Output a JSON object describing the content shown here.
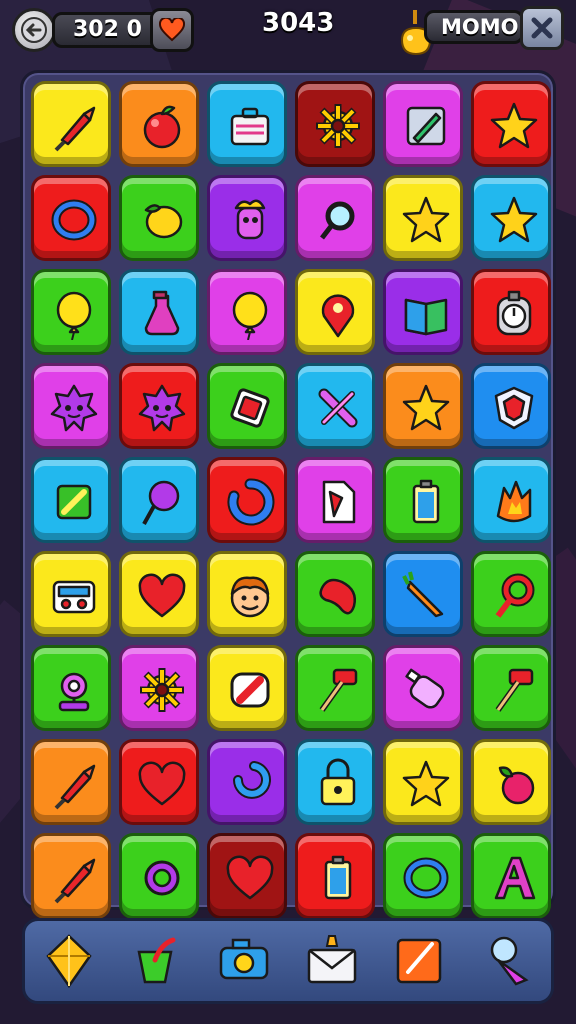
{
  "hud": {
    "score_left": "302 0",
    "center_score": "3043",
    "player_name": "MOMO"
  },
  "colors": {
    "yellow": "#fbe81c",
    "orange": "#fb8c1c",
    "cyan": "#22b8ee",
    "darkred": "#a01414",
    "magenta": "#e040e8",
    "red": "#ee1c1c",
    "green": "#3cd01c",
    "purple": "#9a2ee8",
    "blue": "#1f8ef0"
  },
  "board": {
    "rows": [
      [
        {
          "c": "yellow",
          "i": "rocket-icon"
        },
        {
          "c": "orange",
          "i": "apple-icon"
        },
        {
          "c": "cyan",
          "i": "briefcase-icon"
        },
        {
          "c": "darkred",
          "i": "gear-icon"
        },
        {
          "c": "magenta",
          "i": "pencil-square-icon"
        },
        {
          "c": "red",
          "i": "star-icon"
        }
      ],
      [
        {
          "c": "red",
          "i": "ring-icon"
        },
        {
          "c": "green",
          "i": "lemon-icon"
        },
        {
          "c": "purple",
          "i": "monster-icon"
        },
        {
          "c": "magenta",
          "i": "magnifier-icon"
        },
        {
          "c": "yellow",
          "i": "star-icon"
        },
        {
          "c": "cyan",
          "i": "star-icon"
        }
      ],
      [
        {
          "c": "green",
          "i": "balloon-icon"
        },
        {
          "c": "cyan",
          "i": "potion-icon"
        },
        {
          "c": "magenta",
          "i": "balloon-icon"
        },
        {
          "c": "yellow",
          "i": "map-pin-icon"
        },
        {
          "c": "purple",
          "i": "book-icon"
        },
        {
          "c": "red",
          "i": "stopwatch-icon"
        }
      ],
      [
        {
          "c": "magenta",
          "i": "spiky-monster-icon"
        },
        {
          "c": "red",
          "i": "spiky-monster-icon"
        },
        {
          "c": "green",
          "i": "diamond-icon"
        },
        {
          "c": "cyan",
          "i": "cross-icon"
        },
        {
          "c": "orange",
          "i": "star-icon"
        },
        {
          "c": "blue",
          "i": "shield-icon"
        }
      ],
      [
        {
          "c": "cyan",
          "i": "note-icon"
        },
        {
          "c": "cyan",
          "i": "lollipop-icon"
        },
        {
          "c": "red",
          "i": "swirl-icon"
        },
        {
          "c": "magenta",
          "i": "document-icon"
        },
        {
          "c": "green",
          "i": "battery-icon"
        },
        {
          "c": "cyan",
          "i": "flame-icon"
        }
      ],
      [
        {
          "c": "yellow",
          "i": "radio-icon"
        },
        {
          "c": "yellow",
          "i": "heart-icon"
        },
        {
          "c": "yellow",
          "i": "face-icon"
        },
        {
          "c": "green",
          "i": "bean-icon"
        },
        {
          "c": "blue",
          "i": "carrot-icon"
        },
        {
          "c": "green",
          "i": "key-icon"
        }
      ],
      [
        {
          "c": "green",
          "i": "webcam-icon"
        },
        {
          "c": "magenta",
          "i": "gear-icon"
        },
        {
          "c": "yellow",
          "i": "badge-icon"
        },
        {
          "c": "green",
          "i": "hammer-icon"
        },
        {
          "c": "magenta",
          "i": "bottle-icon"
        },
        {
          "c": "green",
          "i": "hammer-icon"
        }
      ],
      [
        {
          "c": "orange",
          "i": "rocket-icon"
        },
        {
          "c": "red",
          "i": "heart-icon"
        },
        {
          "c": "purple",
          "i": "hook-icon"
        },
        {
          "c": "cyan",
          "i": "lock-icon"
        },
        {
          "c": "yellow",
          "i": "star-icon"
        },
        {
          "c": "yellow",
          "i": "berry-icon"
        }
      ],
      [
        {
          "c": "orange",
          "i": "rocket-icon"
        },
        {
          "c": "green",
          "i": "flower-icon"
        },
        {
          "c": "darkred",
          "i": "heart-icon"
        },
        {
          "c": "red",
          "i": "battery-icon"
        },
        {
          "c": "green",
          "i": "ring-icon"
        },
        {
          "c": "green",
          "i": "letter-a-icon"
        }
      ]
    ]
  },
  "toolbar": {
    "tools": [
      "gem-tool-icon",
      "paint-bucket-tool-icon",
      "camera-tool-icon",
      "envelope-tool-icon",
      "card-tool-icon",
      "ice-cream-tool-icon"
    ]
  }
}
